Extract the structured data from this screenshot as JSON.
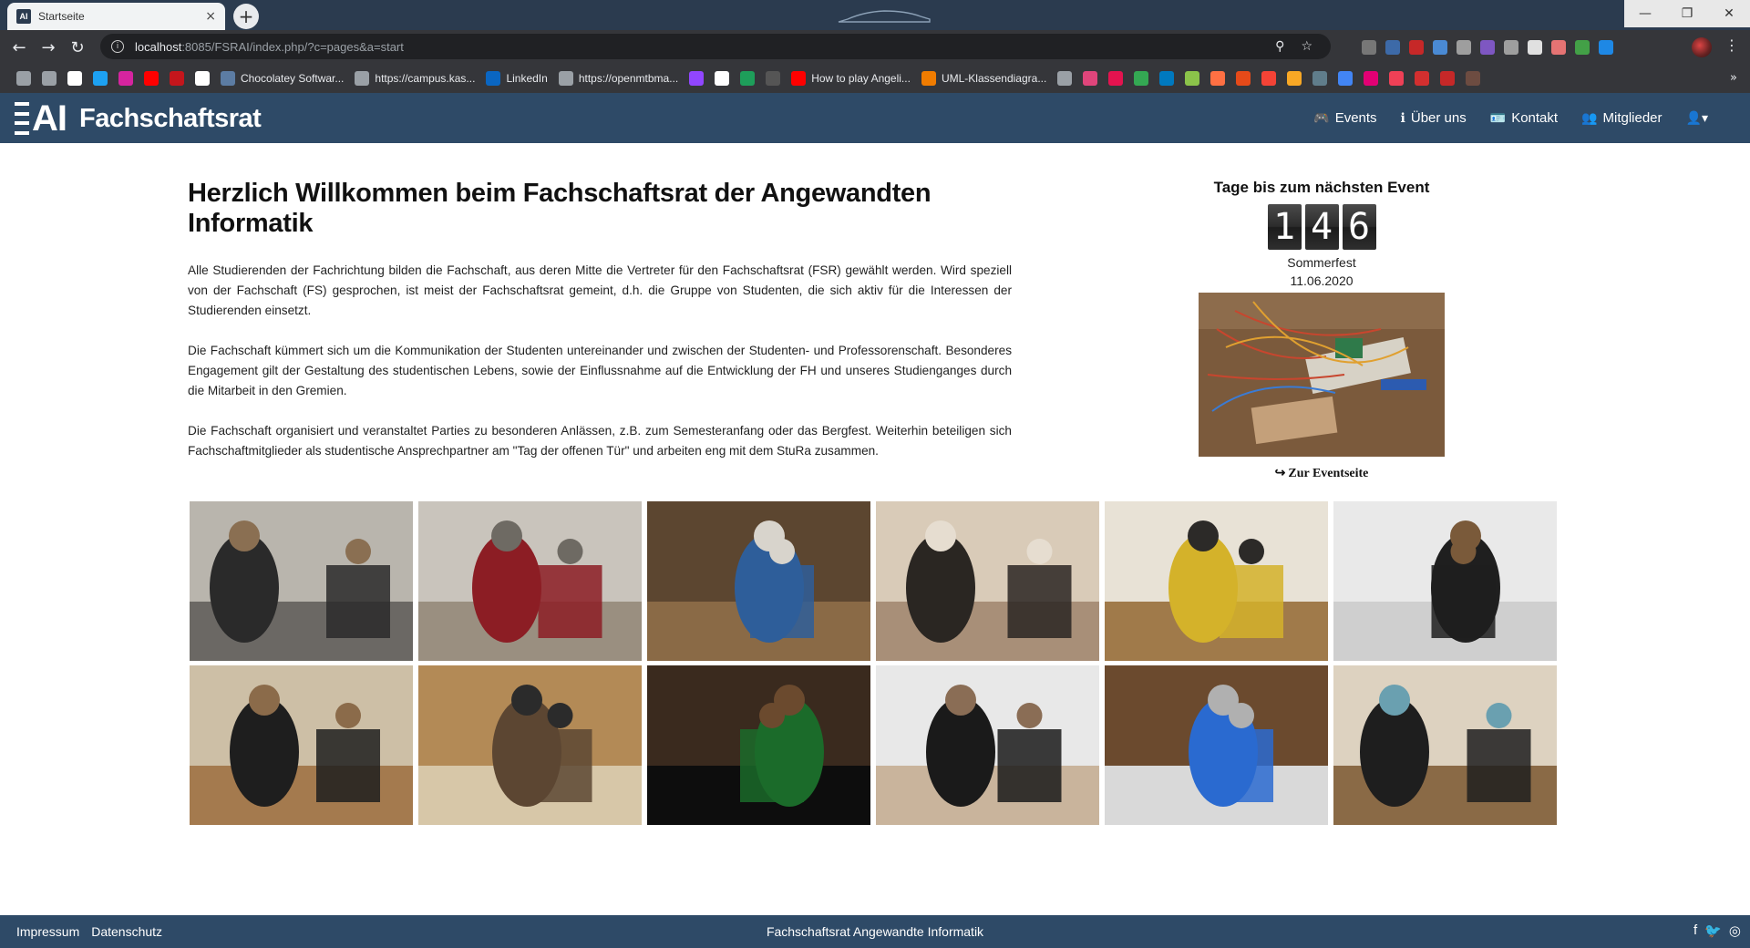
{
  "browser": {
    "tab_title": "Startseite",
    "tab_favicon": "AI",
    "tab_close": "×",
    "new_tab": "+",
    "url_host": "localhost",
    "url_rest": ":8085/FSRAI/index.php/?c=pages&a=start",
    "window_controls": {
      "minimize": "—",
      "maximize": "❐",
      "close": "✕"
    },
    "nav": {
      "back": "←",
      "forward": "→",
      "reload": "↻"
    },
    "omni_icons": {
      "zoom": "⚲",
      "star": "☆"
    },
    "menu": "⋮",
    "bookmarks": [
      {
        "label": "",
        "icon": "history-icon",
        "color": "#9aa0a6"
      },
      {
        "label": "",
        "icon": "download-icon",
        "color": "#9aa0a6"
      },
      {
        "label": "",
        "icon": "google-icon",
        "color": "#ffffff"
      },
      {
        "label": "",
        "icon": "twitter-icon",
        "color": "#1da1f2"
      },
      {
        "label": "",
        "icon": "instagram-icon",
        "color": "#d6249f"
      },
      {
        "label": "",
        "icon": "youtube-icon",
        "color": "#ff0000"
      },
      {
        "label": "",
        "icon": "bookmark-red-icon",
        "color": "#c4161c"
      },
      {
        "label": "",
        "icon": "amazon-icon",
        "color": "#ffffff"
      },
      {
        "label": "Chocolatey Softwar...",
        "icon": "chocolatey-icon",
        "color": "#5c7ca3"
      },
      {
        "label": "https://campus.kas...",
        "icon": "globe-icon",
        "color": "#9aa0a6"
      },
      {
        "label": "LinkedIn",
        "icon": "linkedin-icon",
        "color": "#0a66c2"
      },
      {
        "label": "https://openmtbma...",
        "icon": "globe-icon",
        "color": "#9aa0a6"
      },
      {
        "label": "",
        "icon": "twitch-icon",
        "color": "#9146ff"
      },
      {
        "label": "",
        "icon": "github-icon",
        "color": "#ffffff"
      },
      {
        "label": "",
        "icon": "bookmark-green-icon",
        "color": "#1e9e5a"
      },
      {
        "label": "",
        "icon": "bookmark-dark-icon",
        "color": "#555555"
      },
      {
        "label": "How to play Angeli...",
        "icon": "youtube-icon",
        "color": "#ff0000"
      },
      {
        "label": "UML-Klassendiagra...",
        "icon": "uml-icon",
        "color": "#f07c00"
      },
      {
        "label": "",
        "icon": "globe-icon",
        "color": "#9aa0a6"
      },
      {
        "label": "",
        "icon": "bookmark-circle-icon",
        "color": "#e0457b"
      },
      {
        "label": "",
        "icon": "bookmark-m-icon",
        "color": "#e4134f"
      },
      {
        "label": "",
        "icon": "drive-icon",
        "color": "#34a853"
      },
      {
        "label": "",
        "icon": "trello-icon",
        "color": "#0079bf"
      },
      {
        "label": "",
        "icon": "bookmark-swirl-icon",
        "color": "#8bc34a"
      },
      {
        "label": "",
        "icon": "bookmark-orange-icon",
        "color": "#ff7043"
      },
      {
        "label": "",
        "icon": "bookmark-box-icon",
        "color": "#e64a19"
      },
      {
        "label": "",
        "icon": "bookmark-red2-icon",
        "color": "#f44336"
      },
      {
        "label": "",
        "icon": "bookmark-yellow-icon",
        "color": "#f9a825"
      },
      {
        "label": "",
        "icon": "bookmark-lt-icon",
        "color": "#607d8b"
      },
      {
        "label": "",
        "icon": "translate-icon",
        "color": "#4285f4"
      },
      {
        "label": "",
        "icon": "telekom-icon",
        "color": "#e20074"
      },
      {
        "label": "",
        "icon": "pocket-icon",
        "color": "#ef4056"
      },
      {
        "label": "",
        "icon": "bookmark-flag-icon",
        "color": "#d32f2f"
      },
      {
        "label": "",
        "icon": "bookmark-ring-icon",
        "color": "#c62828"
      },
      {
        "label": "",
        "icon": "bookmark-avatar-icon",
        "color": "#6d4c41"
      }
    ],
    "bookmarks_more": "»",
    "extensions": [
      "#777777",
      "#3d6aa8",
      "#c62828",
      "#4a8ad4",
      "#9e9e9e",
      "#7e57c2",
      "#9e9e9e",
      "#e0e0e0",
      "#e57373",
      "#43a047",
      "#1e88e5"
    ]
  },
  "site": {
    "brand_ai": "AI",
    "brand_name": "Fachschaftsrat",
    "nav": [
      {
        "label": "Events",
        "icon": "gamepad-icon",
        "glyph": "🎮"
      },
      {
        "label": "Über uns",
        "icon": "info-icon",
        "glyph": "ℹ"
      },
      {
        "label": "Kontakt",
        "icon": "id-card-icon",
        "glyph": "🪪"
      },
      {
        "label": "Mitglieder",
        "icon": "users-icon",
        "glyph": "👥"
      },
      {
        "label": "",
        "icon": "user-dropdown-icon",
        "glyph": "👤▾"
      }
    ]
  },
  "main": {
    "title": "Herzlich Willkommen beim Fachschaftsrat der Angewandten Informatik",
    "paragraphs": [
      "Alle Studierenden der Fachrichtung bilden die Fachschaft, aus deren Mitte die Vertreter für den Fachschaftsrat (FSR) gewählt werden. Wird speziell von der Fachschaft (FS) gesprochen, ist meist der Fachschaftsrat gemeint, d.h. die Gruppe von Studenten, die sich aktiv für die Interessen der Studierenden einsetzt.",
      "Die Fachschaft kümmert sich um die Kommunikation der Studenten untereinander und zwischen der Studenten- und Professorenschaft. Besonderes Engagement gilt der Gestaltung des studentischen Lebens, sowie der Einflussnahme auf die Entwicklung der FH und unseres Studienganges durch die Mitarbeit in den Gremien.",
      "Die Fachschaft organisiert und veranstaltet Parties zu besonderen Anlässen, z.B. zum Semesteranfang oder das Bergfest. Weiterhin beteiligen sich Fachschaftmitglieder als studentische Ansprechpartner am \"Tag der offenen Tür\" und arbeiten eng mit dem StuRa zusammen."
    ]
  },
  "event": {
    "heading": "Tage bis zum nächsten Event",
    "digits": [
      "1",
      "4",
      "6"
    ],
    "name": "Sommerfest",
    "date": "11.06.2020",
    "link_arrow": "↪",
    "link_label": "Zur Eventseite"
  },
  "gallery": [
    {
      "name": "photo-hackathon-group",
      "colors": [
        "#b9b5ad",
        "#6b6864",
        "#2a2a2a",
        "#8a6f52"
      ]
    },
    {
      "name": "photo-four-students",
      "colors": [
        "#c9c4bc",
        "#9a8f80",
        "#8c1d24",
        "#6e6a63"
      ]
    },
    {
      "name": "photo-electronics-board",
      "colors": [
        "#5c4630",
        "#8a6a46",
        "#2e5e9a",
        "#d8d4cc"
      ]
    },
    {
      "name": "photo-student-portrait",
      "colors": [
        "#d9cbb8",
        "#a88f78",
        "#2a2622",
        "#e6ddd0"
      ]
    },
    {
      "name": "photo-student-at-desk",
      "colors": [
        "#e8e2d6",
        "#a07a4a",
        "#d4b22a",
        "#2c2a28"
      ]
    },
    {
      "name": "photo-tshirt-wall",
      "colors": [
        "#e9e9e9",
        "#cfcfcf",
        "#1f1f1f",
        "#7a5a3a"
      ]
    },
    {
      "name": "photo-two-friends",
      "colors": [
        "#cdbfa6",
        "#a47a4e",
        "#1e1e1e",
        "#8b6b4a"
      ]
    },
    {
      "name": "photo-hall-tables",
      "colors": [
        "#b38a56",
        "#d7c7a8",
        "#5c4632",
        "#2b2b2b"
      ]
    },
    {
      "name": "photo-laptop-matrix",
      "colors": [
        "#3a2a1e",
        "#0d0d0d",
        "#1b6b2a",
        "#6b4a2e"
      ]
    },
    {
      "name": "photo-two-smiling",
      "colors": [
        "#e8e8e8",
        "#c9b49c",
        "#1a1a1a",
        "#8a6d55"
      ]
    },
    {
      "name": "photo-component-box",
      "colors": [
        "#6b4a2e",
        "#d9d9d9",
        "#2a6ad0",
        "#b0b0b0"
      ]
    },
    {
      "name": "photo-back-at-laptop",
      "colors": [
        "#ddd2c0",
        "#8a6a46",
        "#1e1e1e",
        "#6aa0b0"
      ]
    }
  ],
  "footer": {
    "impressum": "Impressum",
    "datenschutz": "Datenschutz",
    "center": "Fachschaftsrat Angewandte Informatik",
    "social": [
      {
        "icon": "facebook-icon",
        "glyph": "f"
      },
      {
        "icon": "twitter-icon",
        "glyph": "🐦"
      },
      {
        "icon": "instagram-icon",
        "glyph": "◎"
      }
    ]
  }
}
